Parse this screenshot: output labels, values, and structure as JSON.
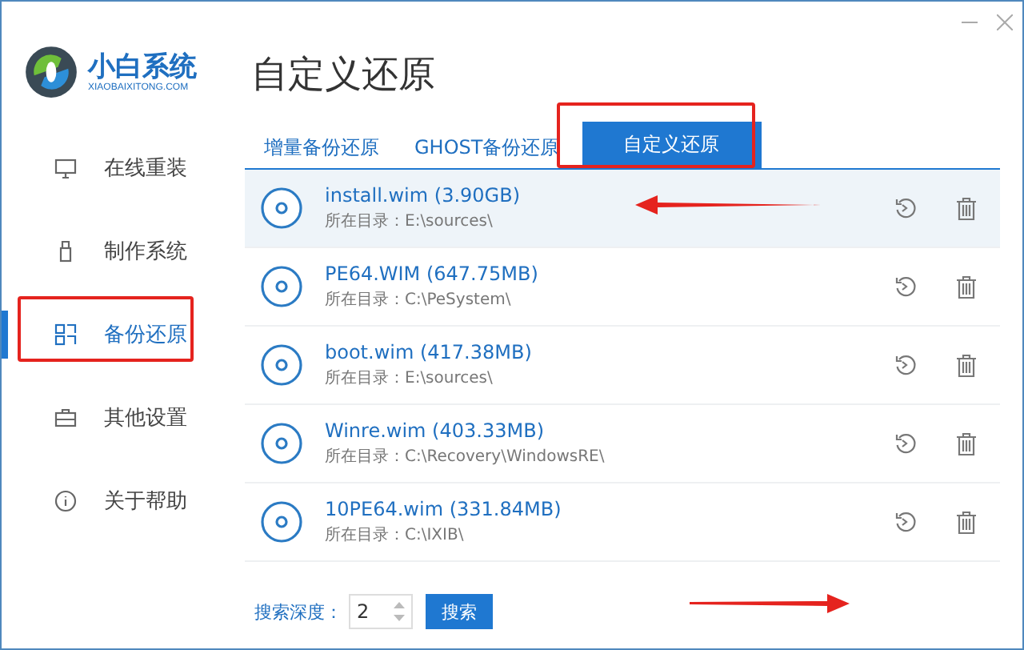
{
  "logo": {
    "name": "小白系统",
    "subtitle": "XIAOBAIXITONG.COM"
  },
  "nav": [
    {
      "label": "在线重装",
      "selected": false
    },
    {
      "label": "制作系统",
      "selected": false
    },
    {
      "label": "备份还原",
      "selected": true
    },
    {
      "label": "其他设置",
      "selected": false
    },
    {
      "label": "关于帮助",
      "selected": false
    }
  ],
  "page_title": "自定义还原",
  "tabs": [
    {
      "label": "增量备份还原",
      "selected": false
    },
    {
      "label": "GHOST备份还原",
      "selected": false
    },
    {
      "label": "自定义还原",
      "selected": true
    }
  ],
  "files": [
    {
      "name": "install.wim (3.90GB)",
      "path": "所在目录：E:\\sources\\",
      "selected": true
    },
    {
      "name": "PE64.WIM (647.75MB)",
      "path": "所在目录：C:\\PeSystem\\",
      "selected": false
    },
    {
      "name": "boot.wim (417.38MB)",
      "path": "所在目录：E:\\sources\\",
      "selected": false
    },
    {
      "name": "Winre.wim (403.33MB)",
      "path": "所在目录：C:\\Recovery\\WindowsRE\\",
      "selected": false
    },
    {
      "name": "10PE64.wim (331.84MB)",
      "path": "所在目录：C:\\IXIB\\",
      "selected": false
    }
  ],
  "search": {
    "label": "搜索深度：",
    "value": "2",
    "button": "搜索"
  }
}
